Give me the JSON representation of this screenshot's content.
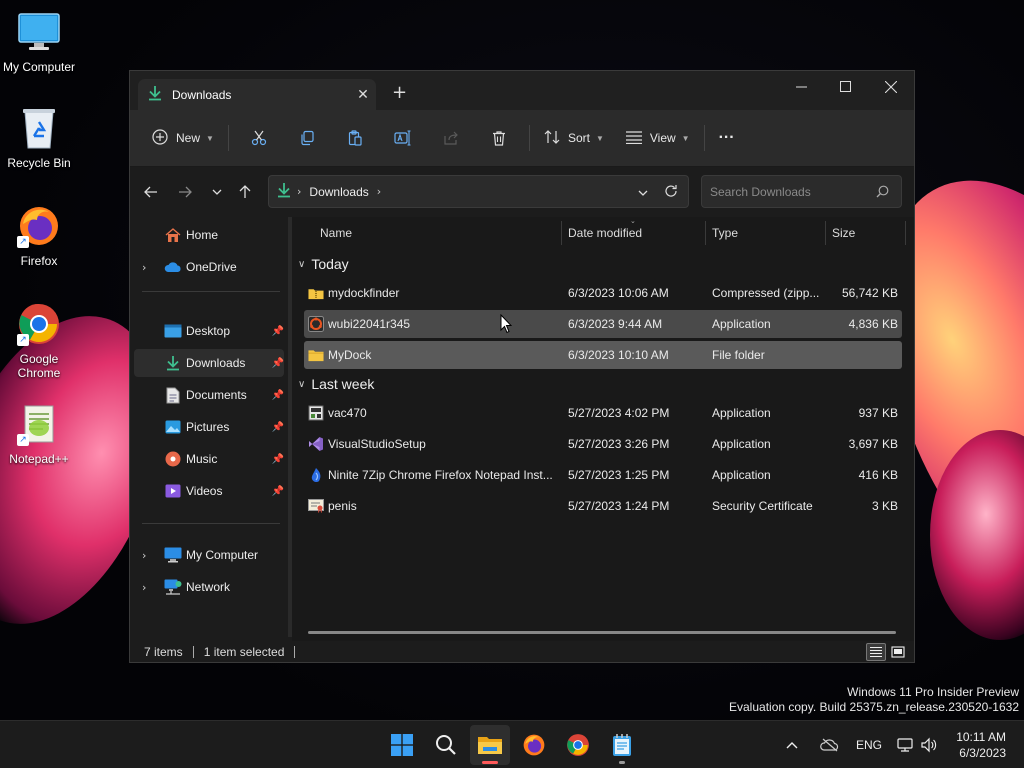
{
  "desktop": {
    "icons": [
      {
        "label": "My Computer",
        "icon": "monitor-icon"
      },
      {
        "label": "Recycle Bin",
        "icon": "recycle-bin-icon"
      },
      {
        "label": "Firefox",
        "icon": "firefox-icon"
      },
      {
        "label": "Google Chrome",
        "icon": "chrome-icon"
      },
      {
        "label": "Notepad++",
        "icon": "notepadpp-icon"
      }
    ]
  },
  "window": {
    "tab_title": "Downloads",
    "new_tab_symbol": "+",
    "toolbar": {
      "new_label": "New",
      "sort_label": "Sort",
      "view_label": "View",
      "more_label": "···"
    },
    "address": {
      "crumb": "Downloads"
    },
    "search": {
      "placeholder": "Search Downloads"
    },
    "sidebar": {
      "items": [
        {
          "label": "Home",
          "icon": "home-icon"
        },
        {
          "label": "OneDrive",
          "icon": "onedrive-icon"
        },
        {
          "label": "Desktop",
          "icon": "desktop-folder-icon"
        },
        {
          "label": "Downloads",
          "icon": "download-icon"
        },
        {
          "label": "Documents",
          "icon": "documents-icon"
        },
        {
          "label": "Pictures",
          "icon": "pictures-icon"
        },
        {
          "label": "Music",
          "icon": "music-icon"
        },
        {
          "label": "Videos",
          "icon": "videos-icon"
        },
        {
          "label": "My Computer",
          "icon": "monitor-icon"
        },
        {
          "label": "Network",
          "icon": "network-icon"
        }
      ]
    },
    "columns": {
      "name": "Name",
      "date": "Date modified",
      "type": "Type",
      "size": "Size"
    },
    "groups": {
      "today": "Today",
      "last_week": "Last week"
    },
    "files": [
      {
        "name": "mydockfinder",
        "date": "6/3/2023 10:06 AM",
        "type": "Compressed (zipp...",
        "size": "56,742 KB",
        "icon": "zip-folder-icon"
      },
      {
        "name": "wubi22041r345",
        "date": "6/3/2023 9:44 AM",
        "type": "Application",
        "size": "4,836 KB",
        "icon": "ubuntu-app-icon"
      },
      {
        "name": "MyDock",
        "date": "6/3/2023 10:10 AM",
        "type": "File folder",
        "size": "",
        "icon": "folder-icon"
      },
      {
        "name": "vac470",
        "date": "5/27/2023 4:02 PM",
        "type": "Application",
        "size": "937 KB",
        "icon": "installer-icon"
      },
      {
        "name": "VisualStudioSetup",
        "date": "5/27/2023 3:26 PM",
        "type": "Application",
        "size": "3,697 KB",
        "icon": "visual-studio-icon"
      },
      {
        "name": "Ninite 7Zip Chrome Firefox Notepad Inst...",
        "date": "5/27/2023 1:25 PM",
        "type": "Application",
        "size": "416 KB",
        "icon": "ninite-icon"
      },
      {
        "name": "penis",
        "date": "5/27/2023 1:24 PM",
        "type": "Security Certificate",
        "size": "3 KB",
        "icon": "certificate-icon"
      }
    ],
    "status": {
      "items": "7 items",
      "selected": "1 item selected"
    }
  },
  "watermark": {
    "line1": "Windows 11 Pro Insider Preview",
    "line2": "Evaluation copy. Build 25375.zn_release.230520-1632"
  },
  "taskbar": {
    "language": "ENG",
    "time": "10:11 AM",
    "date": "6/3/2023"
  },
  "colors": {
    "accent_download": "#3fbf8f",
    "folder_yellow": "#f4c542",
    "selected_row": "#5a5a5a",
    "hover_row": "#4a4a4a"
  }
}
